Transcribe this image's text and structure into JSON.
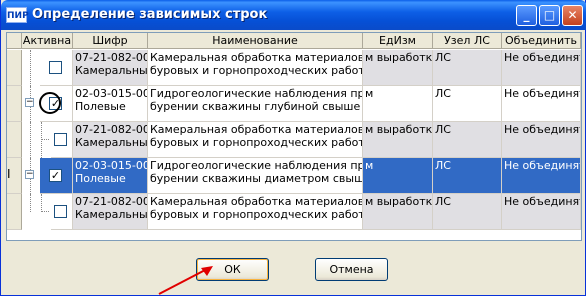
{
  "window": {
    "app_icon_text": "ПИР",
    "title": "Определение зависимых строк"
  },
  "grid": {
    "columns": [
      "Активна",
      "Шифр",
      "Наименование",
      "ЕдИзм",
      "Узел ЛС",
      "Объединить"
    ],
    "rows": [
      {
        "checked": false,
        "shifr": "07-21-082-001\nКамеральные",
        "naim": "Камеральная обработка материалов\nбуровых и горнопроходческих работ",
        "edizm": "м выработки",
        "uzel": "ЛС",
        "obed": "Не объединять"
      },
      {
        "checked": true,
        "shifr": "02-03-015-002\nПолевые",
        "naim": "Гидрогеологические наблюдения при\nбурении скважины глубиной свыше 5 до",
        "edizm": "м",
        "uzel": "ЛС",
        "obed": "Не объединять"
      },
      {
        "checked": false,
        "shifr": "07-21-082-002\nКамеральные",
        "naim": "Камеральная обработка материалов\nбуровых и горнопроходческих работ с",
        "edizm": "м выработки",
        "uzel": "ЛС",
        "obed": "Не объединять"
      },
      {
        "checked": true,
        "shifr": "02-03-015-001\nПолевые",
        "naim": "Гидрогеологические наблюдения при\nбурении скважины диаметром свыше 60",
        "edizm": "м",
        "uzel": "ЛС",
        "obed": "Не объединять"
      },
      {
        "checked": false,
        "shifr": "07-21-082-002\nКамеральные",
        "naim": "Камеральная обработка материалов\nбуровых и горнопроходческих работ с",
        "edizm": "м выработки",
        "uzel": "ЛС",
        "obed": "Не объединять"
      }
    ]
  },
  "buttons": {
    "ok": "ОК",
    "cancel": "Отмена"
  },
  "colors": {
    "selection": "#316ac5",
    "annotation": "#e00000"
  }
}
